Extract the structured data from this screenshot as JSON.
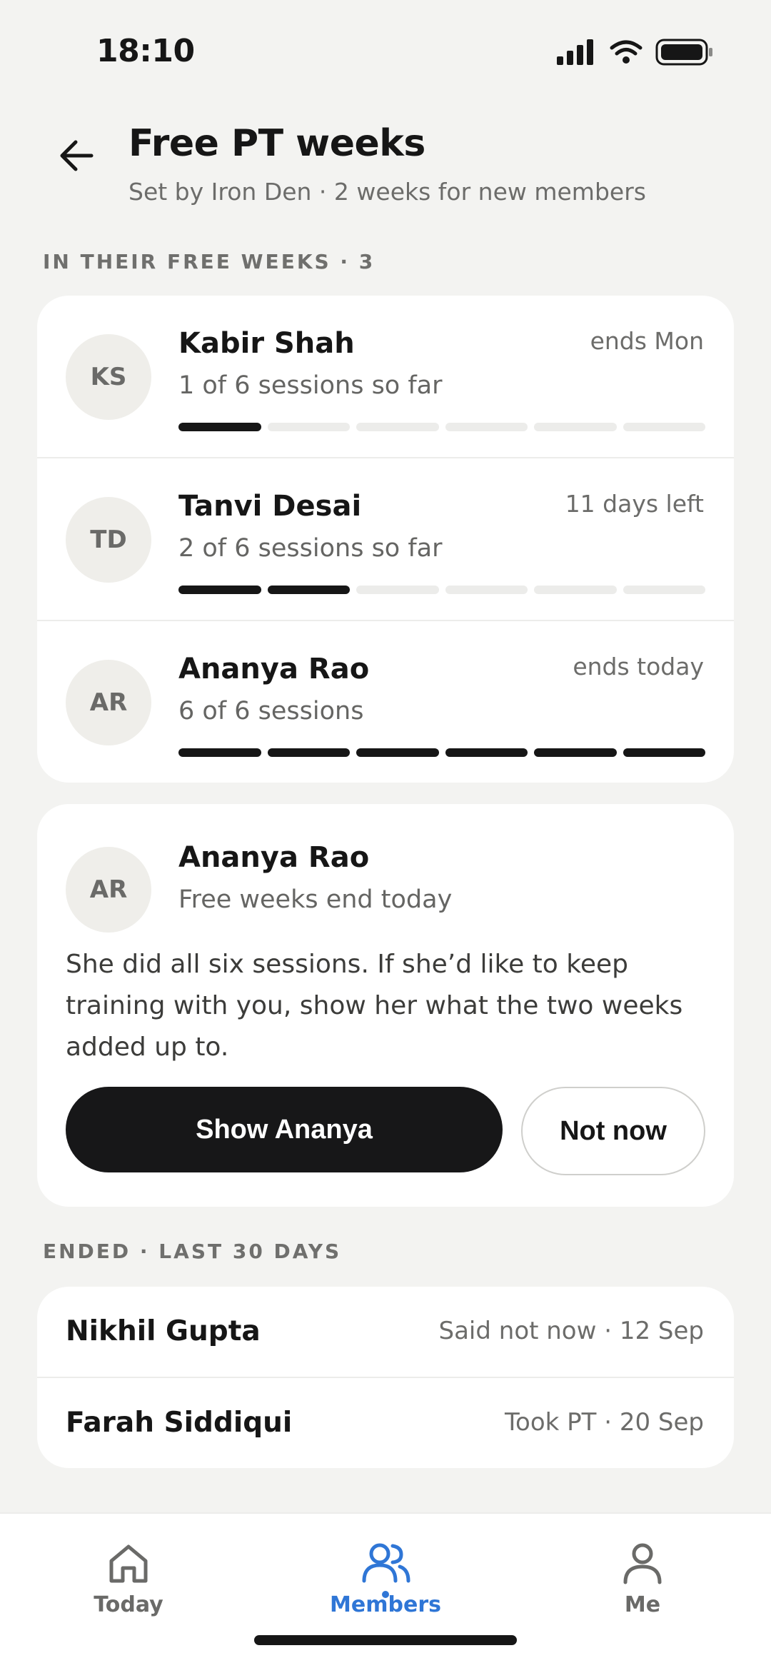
{
  "status_bar": {
    "time": "18:10"
  },
  "header": {
    "title": "Free PT weeks",
    "subtitle": "Set by Iron Den · 2 weeks for new members"
  },
  "active_section": {
    "label": "IN THEIR FREE WEEKS · 3",
    "members": [
      {
        "initials": "KS",
        "name": "Kabir Shah",
        "sessions": "1 of 6 sessions so far",
        "status": "ends Mon",
        "done": 1,
        "total": 6
      },
      {
        "initials": "TD",
        "name": "Tanvi Desai",
        "sessions": "2 of 6 sessions so far",
        "status": "11 days left",
        "done": 2,
        "total": 6
      },
      {
        "initials": "AR",
        "name": "Ananya Rao",
        "sessions": "6 of 6 sessions",
        "status": "ends today",
        "done": 6,
        "total": 6
      }
    ]
  },
  "nudge": {
    "initials": "AR",
    "name": "Ananya Rao",
    "subtitle": "Free weeks end today",
    "body": "She did all six sessions. If she’d like to keep training with you, show her what the two weeks added up to.",
    "primary_label": "Show Ananya",
    "secondary_label": "Not now"
  },
  "ended_section": {
    "label": "ENDED · LAST 30 DAYS",
    "rows": [
      {
        "name": "Nikhil Gupta",
        "status": "Said not now · 12 Sep"
      },
      {
        "name": "Farah Siddiqui",
        "status": "Took PT · 20 Sep"
      }
    ]
  },
  "tabs": [
    {
      "label": "Today",
      "icon": "home-icon"
    },
    {
      "label": "Members",
      "icon": "members-icon",
      "active": true
    },
    {
      "label": "Me",
      "icon": "person-icon"
    }
  ],
  "colors": {
    "accent": "#2f76d6",
    "primary_button": "#171718",
    "background": "#f3f3f1"
  }
}
